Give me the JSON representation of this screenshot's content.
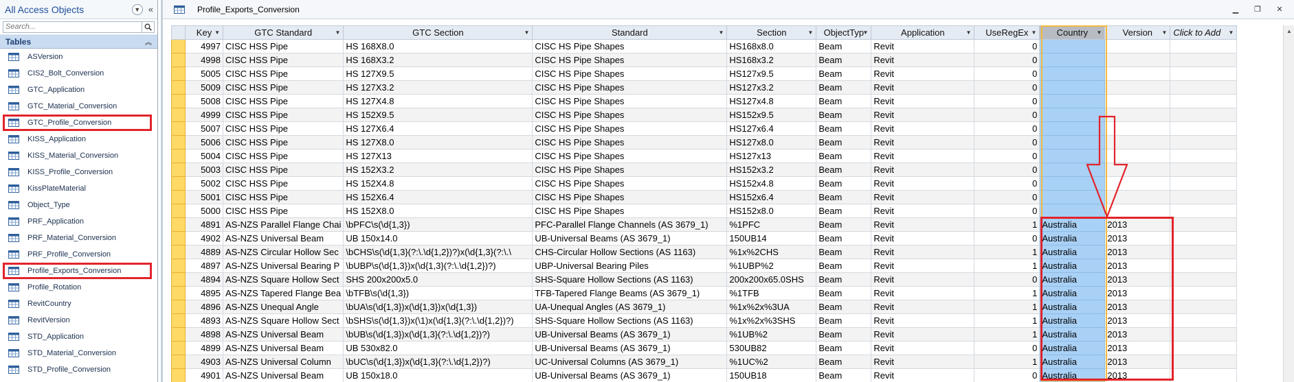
{
  "nav": {
    "title": "All Access Objects",
    "search_placeholder": "Search...",
    "group_title": "Tables",
    "items": [
      {
        "label": "ASVersion",
        "selected": false
      },
      {
        "label": "CIS2_Bolt_Conversion",
        "selected": false
      },
      {
        "label": "GTC_Application",
        "selected": false
      },
      {
        "label": "GTC_Material_Conversion",
        "selected": false
      },
      {
        "label": "GTC_Profile_Conversion",
        "selected": true
      },
      {
        "label": "KISS_Application",
        "selected": false
      },
      {
        "label": "KISS_Material_Conversion",
        "selected": false
      },
      {
        "label": "KISS_Profile_Conversion",
        "selected": false
      },
      {
        "label": "KissPlateMaterial",
        "selected": false
      },
      {
        "label": "Object_Type",
        "selected": false
      },
      {
        "label": "PRF_Application",
        "selected": false
      },
      {
        "label": "PRF_Material_Conversion",
        "selected": false
      },
      {
        "label": "PRF_Profile_Conversion",
        "selected": false
      },
      {
        "label": "Profile_Exports_Conversion",
        "selected": true
      },
      {
        "label": "Profile_Rotation",
        "selected": false
      },
      {
        "label": "RevitCountry",
        "selected": false
      },
      {
        "label": "RevitVersion",
        "selected": false
      },
      {
        "label": "STD_Application",
        "selected": false
      },
      {
        "label": "STD_Material_Conversion",
        "selected": false
      },
      {
        "label": "STD_Profile_Conversion",
        "selected": false
      }
    ]
  },
  "document": {
    "title": "Profile_Exports_Conversion"
  },
  "grid": {
    "columns": [
      "Key",
      "GTC Standard",
      "GTC Section",
      "Standard",
      "Section",
      "ObjectTyp",
      "Application",
      "UseRegEx",
      "Country",
      "Version",
      "Click to Add"
    ],
    "selected_column": "Country",
    "rows": [
      [
        "4997",
        "CISC HSS Pipe",
        "HS 168X8.0",
        "CISC HS Pipe Shapes",
        "HS168x8.0",
        "Beam",
        "Revit",
        "0",
        "",
        ""
      ],
      [
        "4998",
        "CISC HSS Pipe",
        "HS 168X3.2",
        "CISC HS Pipe Shapes",
        "HS168x3.2",
        "Beam",
        "Revit",
        "0",
        "",
        ""
      ],
      [
        "5005",
        "CISC HSS Pipe",
        "HS 127X9.5",
        "CISC HS Pipe Shapes",
        "HS127x9.5",
        "Beam",
        "Revit",
        "0",
        "",
        ""
      ],
      [
        "5009",
        "CISC HSS Pipe",
        "HS 127X3.2",
        "CISC HS Pipe Shapes",
        "HS127x3.2",
        "Beam",
        "Revit",
        "0",
        "",
        ""
      ],
      [
        "5008",
        "CISC HSS Pipe",
        "HS 127X4.8",
        "CISC HS Pipe Shapes",
        "HS127x4.8",
        "Beam",
        "Revit",
        "0",
        "",
        ""
      ],
      [
        "4999",
        "CISC HSS Pipe",
        "HS 152X9.5",
        "CISC HS Pipe Shapes",
        "HS152x9.5",
        "Beam",
        "Revit",
        "0",
        "",
        ""
      ],
      [
        "5007",
        "CISC HSS Pipe",
        "HS 127X6.4",
        "CISC HS Pipe Shapes",
        "HS127x6.4",
        "Beam",
        "Revit",
        "0",
        "",
        ""
      ],
      [
        "5006",
        "CISC HSS Pipe",
        "HS 127X8.0",
        "CISC HS Pipe Shapes",
        "HS127x8.0",
        "Beam",
        "Revit",
        "0",
        "",
        ""
      ],
      [
        "5004",
        "CISC HSS Pipe",
        "HS 127X13",
        "CISC HS Pipe Shapes",
        "HS127x13",
        "Beam",
        "Revit",
        "0",
        "",
        ""
      ],
      [
        "5003",
        "CISC HSS Pipe",
        "HS 152X3.2",
        "CISC HS Pipe Shapes",
        "HS152x3.2",
        "Beam",
        "Revit",
        "0",
        "",
        ""
      ],
      [
        "5002",
        "CISC HSS Pipe",
        "HS 152X4.8",
        "CISC HS Pipe Shapes",
        "HS152x4.8",
        "Beam",
        "Revit",
        "0",
        "",
        ""
      ],
      [
        "5001",
        "CISC HSS Pipe",
        "HS 152X6.4",
        "CISC HS Pipe Shapes",
        "HS152x6.4",
        "Beam",
        "Revit",
        "0",
        "",
        ""
      ],
      [
        "5000",
        "CISC HSS Pipe",
        "HS 152X8.0",
        "CISC HS Pipe Shapes",
        "HS152x8.0",
        "Beam",
        "Revit",
        "0",
        "",
        ""
      ],
      [
        "4891",
        "AS-NZS Parallel Flange Chai",
        "\\bPFC\\s(\\d{1,3})",
        "PFC-Parallel Flange Channels (AS 3679_1)",
        "%1PFC",
        "Beam",
        "Revit",
        "1",
        "Australia",
        "2013"
      ],
      [
        "4902",
        "AS-NZS Universal Beam",
        "UB 150x14.0",
        "UB-Universal Beams (AS 3679_1)",
        "150UB14",
        "Beam",
        "Revit",
        "0",
        "Australia",
        "2013"
      ],
      [
        "4889",
        "AS-NZS Circular Hollow Sec",
        "\\bCHS\\s(\\d{1,3}(?:\\.\\d{1,2})?)x(\\d{1,3}(?:\\.\\",
        "CHS-Circular Hollow Sections (AS 1163)",
        "%1x%2CHS",
        "Beam",
        "Revit",
        "1",
        "Australia",
        "2013"
      ],
      [
        "4897",
        "AS-NZS Universal Bearing P",
        "\\bUBP\\s(\\d{1,3})x(\\d{1,3}(?:\\.\\d{1,2})?)",
        "UBP-Universal Bearing Piles",
        "%1UBP%2",
        "Beam",
        "Revit",
        "1",
        "Australia",
        "2013"
      ],
      [
        "4894",
        "AS-NZS Square Hollow Sect",
        "SHS 200x200x5.0",
        "SHS-Square Hollow Sections (AS 1163)",
        "200x200x65.0SHS",
        "Beam",
        "Revit",
        "0",
        "Australia",
        "2013"
      ],
      [
        "4895",
        "AS-NZS Tapered Flange Bea",
        "\\bTFB\\s(\\d{1,3})",
        "TFB-Tapered Flange Beams (AS 3679_1)",
        "%1TFB",
        "Beam",
        "Revit",
        "1",
        "Australia",
        "2013"
      ],
      [
        "4896",
        "AS-NZS Unequal Angle",
        "\\bUA\\s(\\d{1,3})x(\\d{1,3})x(\\d{1,3})",
        "UA-Unequal Angles (AS 3679_1)",
        "%1x%2x%3UA",
        "Beam",
        "Revit",
        "1",
        "Australia",
        "2013"
      ],
      [
        "4893",
        "AS-NZS Square Hollow Sect",
        "\\bSHS\\s(\\d{1,3})x(\\1)x(\\d{1,3}(?:\\.\\d{1,2})?)",
        "SHS-Square Hollow Sections (AS 1163)",
        "%1x%2x%3SHS",
        "Beam",
        "Revit",
        "1",
        "Australia",
        "2013"
      ],
      [
        "4898",
        "AS-NZS Universal Beam",
        "\\bUB\\s(\\d{1,3})x(\\d{1,3}(?:\\.\\d{1,2})?)",
        "UB-Universal Beams (AS 3679_1)",
        "%1UB%2",
        "Beam",
        "Revit",
        "1",
        "Australia",
        "2013"
      ],
      [
        "4899",
        "AS-NZS Universal Beam",
        "UB 530x82.0",
        "UB-Universal Beams (AS 3679_1)",
        "530UB82",
        "Beam",
        "Revit",
        "0",
        "Australia",
        "2013"
      ],
      [
        "4903",
        "AS-NZS Universal Column",
        "\\bUC\\s(\\d{1,3})x(\\d{1,3}(?:\\.\\d{1,2})?)",
        "UC-Universal Columns (AS 3679_1)",
        "%1UC%2",
        "Beam",
        "Revit",
        "1",
        "Australia",
        "2013"
      ],
      [
        "4901",
        "AS-NZS Universal Beam",
        "UB 150x18.0",
        "UB-Universal Beams (AS 3679_1)",
        "150UB18",
        "Beam",
        "Revit",
        "0",
        "Australia",
        "2013"
      ]
    ]
  },
  "colors": {
    "selection_red": "#e2232a",
    "selected_column_blue": "#a9d0f5",
    "row_selector_yellow": "#ffd966"
  },
  "icons": {
    "nav_menu": "chevron-down-icon",
    "nav_collapse": "double-chevron-left-icon",
    "search": "search-icon",
    "table_item": "table-icon",
    "window_minimize": "minimize-icon",
    "window_restore": "restore-icon",
    "window_close": "close-icon"
  }
}
